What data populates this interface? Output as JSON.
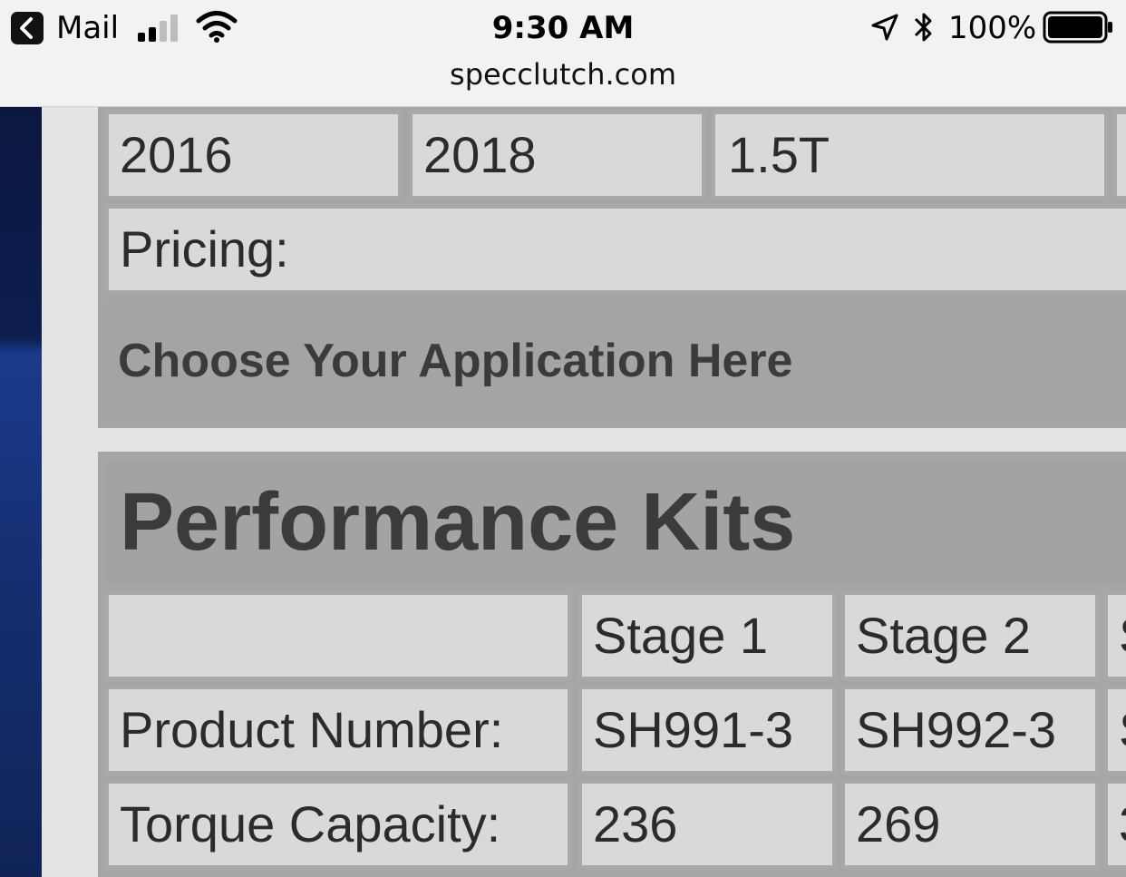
{
  "status_bar": {
    "back_app": "Mail",
    "time": "9:30 AM",
    "battery": "100%"
  },
  "browser": {
    "url": "specclutch.com"
  },
  "vehicle_row": {
    "cells": [
      "2016",
      "2018",
      "1.5T"
    ]
  },
  "pricing_label": "Pricing:",
  "application_button": "Choose Your Application Here",
  "performance": {
    "title": "Performance Kits",
    "header": [
      "",
      "Stage 1",
      "Stage 2",
      "S"
    ],
    "rows": [
      {
        "label": "Product Number:",
        "values": [
          "SH991-3",
          "SH992-3",
          "S"
        ]
      },
      {
        "label": "Torque Capacity:",
        "values": [
          "236",
          "269",
          "3"
        ]
      }
    ]
  },
  "icons": [
    "back-chevron-icon",
    "signal-bars-icon",
    "wifi-icon",
    "location-arrow-icon",
    "bluetooth-icon",
    "battery-icon"
  ]
}
